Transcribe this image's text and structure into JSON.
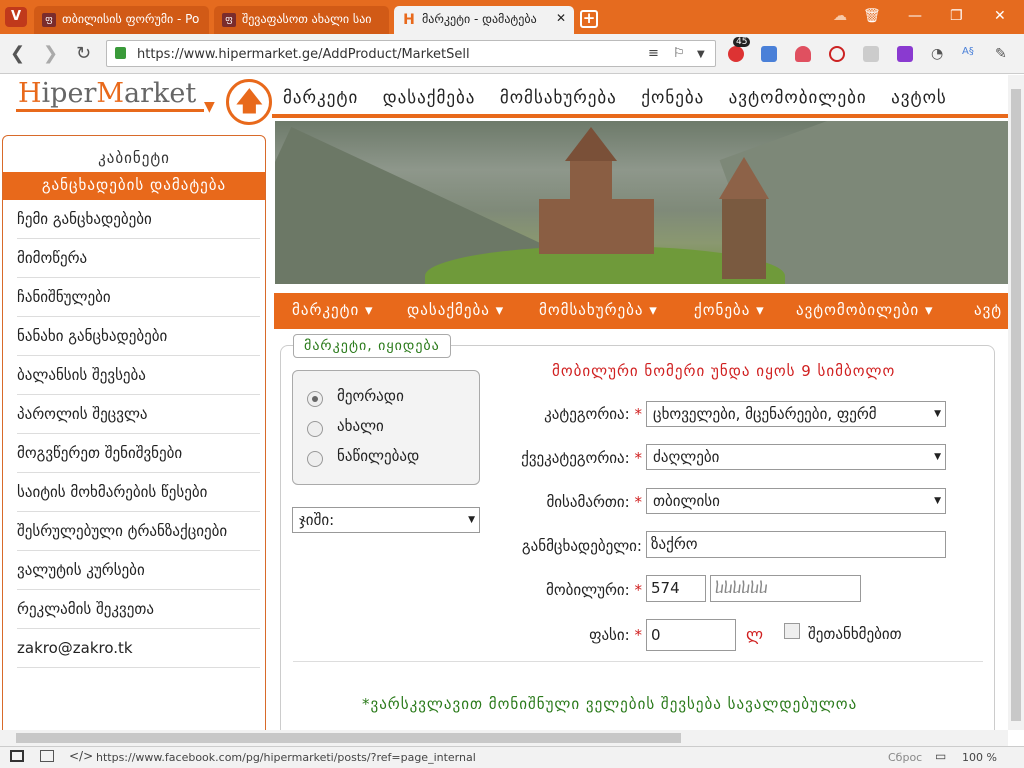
{
  "browser": {
    "tabs": [
      {
        "title": "თბილისის ფორუმი - Po",
        "active": false
      },
      {
        "title": "შევაფასოთ ახალი საი",
        "active": false
      },
      {
        "title": "მარკეტი - დამატება",
        "active": true
      }
    ],
    "url": "https://www.hipermarket.ge/AddProduct/MarketSell",
    "badge": "45",
    "status_url": "https://www.facebook.com/pg/hipermarketi/posts/?ref=page_internal",
    "reset": "Сброс",
    "zoom": "100 %"
  },
  "header": {
    "logo_h": "H",
    "logo_mid": "iper",
    "logo_m": "M",
    "logo_end": "arket",
    "menu": [
      "მარკეტი",
      "დასაქმება",
      "მომსახურება",
      "ქონება",
      "ავტომობილები",
      "ავტოს"
    ]
  },
  "sidebar": {
    "title": "კაბინეტი",
    "add_label": "განცხადების დამატება",
    "items": [
      "ჩემი განცხადებები",
      "მიმოწერა",
      "ჩანიშნულები",
      "ნანახი განცხადებები",
      "ბალანსის შევსება",
      "პაროლის შეცვლა",
      "მოგვწერეთ შენიშვნები",
      "საიტის მოხმარების წესები",
      "შესრულებული ტრანზაქციები",
      "ვალუტის კურსები",
      "რეკლამის შეკვეთა",
      "zakro@zakro.tk"
    ]
  },
  "orange_menu": [
    "მარკეტი ▾",
    "დასაქმება ▾",
    "მომსახურება ▾",
    "ქონება ▾",
    "ავტომობილები ▾",
    "ავტ"
  ],
  "form": {
    "legend": "მარკეტი, იყიდება",
    "condition_options": [
      "მეორადი",
      "ახალი",
      "ნაწილებად"
    ],
    "selected_condition": "მეორადი",
    "type_select": "ჯიში:",
    "warning": "მობილური ნომერი უნდა იყოს 9 სიმბოლო",
    "category_label": "კატეგორია:",
    "category_value": "ცხოველები, მცენარეები, ფერმ",
    "subcategory_label": "ქვეკატეგორია:",
    "subcategory_value": "ძაღლები",
    "address_label": "მისამართი:",
    "address_value": "თბილისი",
    "author_label": "განმცხადებელი:",
    "author_value": "ზაქრო",
    "mobile_label": "მობილური:",
    "mobile_prefix": "574",
    "mobile_number": "ⴑⴑⴑⴑⴑⴑ",
    "price_label": "ფასი:",
    "price_value": "0",
    "currency": "ლ",
    "negotiable_label": "შეთანხმებით",
    "required_mark": "*",
    "footer_note": "*ვარსკვლავით მონიშნული ველების შევსება სავალდებულოა"
  }
}
